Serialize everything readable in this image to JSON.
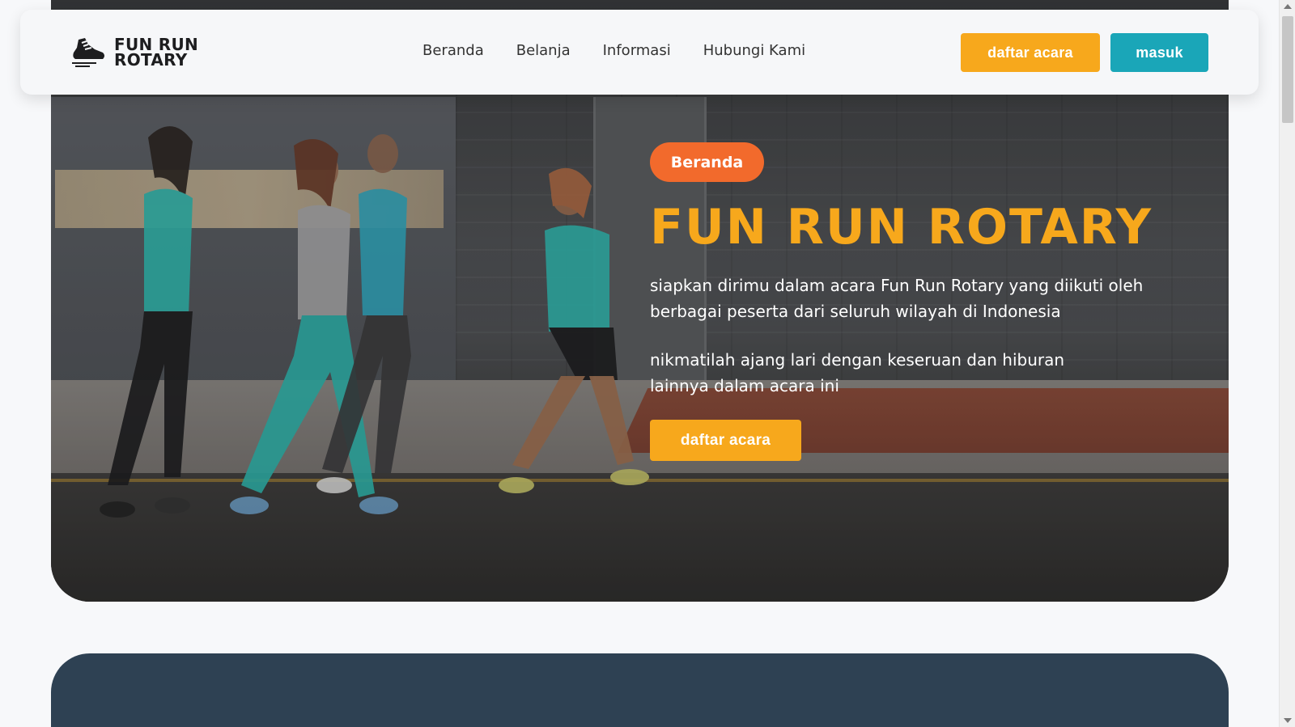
{
  "navbar": {
    "logo_line1": "FUN RUN",
    "logo_line2": "ROTARY",
    "links": [
      {
        "label": "Beranda"
      },
      {
        "label": "Belanja"
      },
      {
        "label": "Informasi"
      },
      {
        "label": "Hubungi Kami"
      }
    ],
    "register_button": "daftar acara",
    "login_button": "masuk"
  },
  "hero": {
    "badge": "Beranda",
    "title": "FUN RUN ROTARY",
    "paragraph1": "siapkan dirimu dalam acara Fun Run Rotary yang diikuti oleh berbagai peserta dari seluruh wilayah di Indonesia",
    "paragraph2": "nikmatilah ajang lari dengan keseruan dan hiburan lainnya dalam acara ini",
    "cta_button": "daftar acara",
    "image_icon": "runners-photo"
  },
  "colors": {
    "accent_orange": "#f7a81c",
    "accent_teal": "#1aa6b8",
    "badge_orange": "#f26a2c",
    "dark_section": "#2e4153"
  }
}
